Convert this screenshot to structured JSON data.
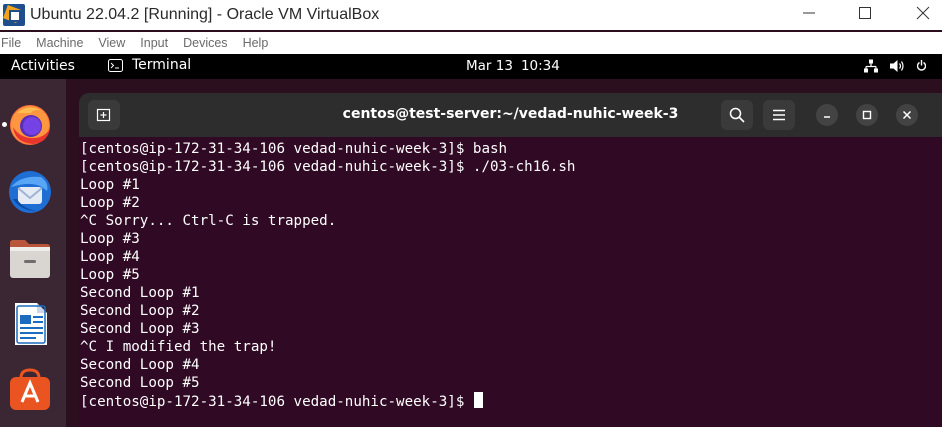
{
  "vbox": {
    "title": "Ubuntu 22.04.2 [Running] - Oracle VM VirtualBox",
    "menu": [
      "File",
      "Machine",
      "View",
      "Input",
      "Devices",
      "Help"
    ]
  },
  "gnome": {
    "activities": "Activities",
    "app_name": "Terminal",
    "date": "Mar 13",
    "time": "10:34"
  },
  "dock": {
    "icons": [
      "firefox-icon",
      "thunderbird-icon",
      "files-icon",
      "libreoffice-writer-icon",
      "app-center-icon"
    ]
  },
  "terminal": {
    "title": "centos@test-server:~/vedad-nuhic-week-3",
    "lines": [
      "[centos@ip-172-31-34-106 vedad-nuhic-week-3]$ bash",
      "[centos@ip-172-31-34-106 vedad-nuhic-week-3]$ ./03-ch16.sh",
      "Loop #1",
      "Loop #2",
      "^C Sorry... Ctrl-C is trapped.",
      "Loop #3",
      "Loop #4",
      "Loop #5",
      "Second Loop #1",
      "Second Loop #2",
      "Second Loop #3",
      "^C I modified the trap!",
      "Second Loop #4",
      "Second Loop #5"
    ],
    "prompt": "[centos@ip-172-31-34-106 vedad-nuhic-week-3]$ "
  },
  "colors": {
    "terminal_bg": "#300a24",
    "headerbar_bg": "#2d2d2d",
    "dock_bg": "#3b2634",
    "topbar_bg": "#000000"
  }
}
